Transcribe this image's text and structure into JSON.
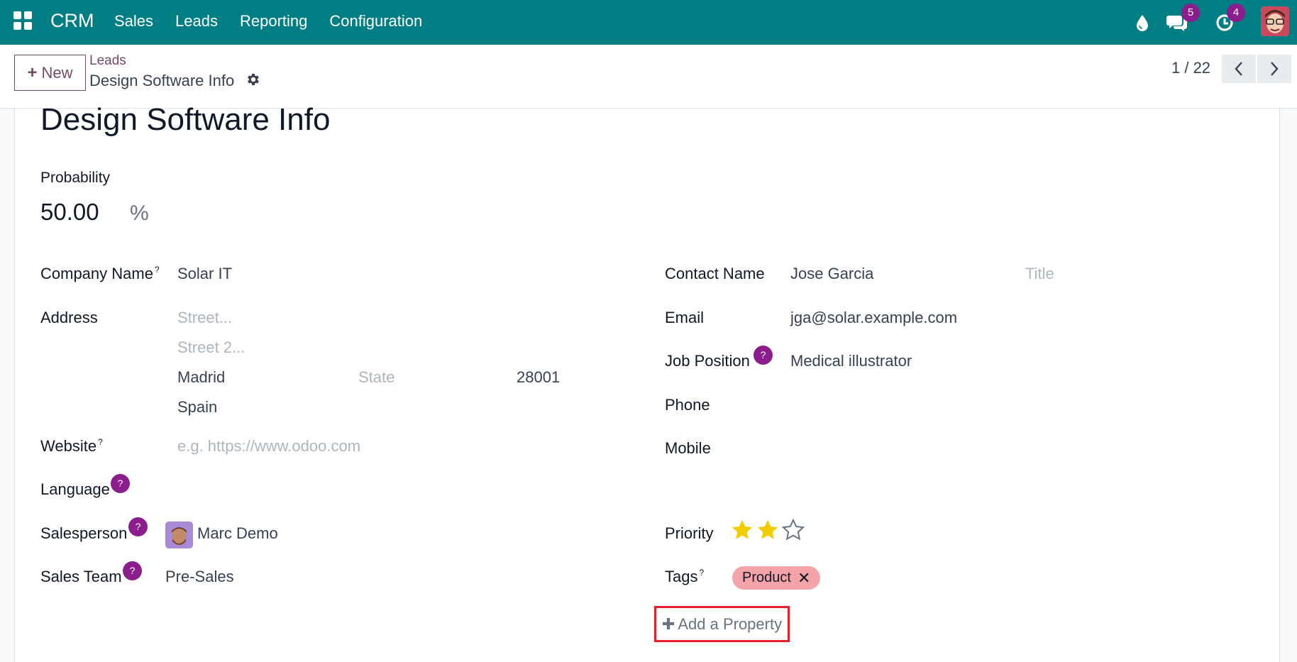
{
  "navbar": {
    "brand": "CRM",
    "menu": [
      "Sales",
      "Leads",
      "Reporting",
      "Configuration"
    ],
    "messages_count": "5",
    "activities_count": "4"
  },
  "control": {
    "new_label": "New",
    "breadcrumb_parent": "Leads",
    "breadcrumb_current": "Design Software Info",
    "pager": "1 / 22"
  },
  "form": {
    "title": "Design Software Info",
    "probability_label": "Probability",
    "probability_value": "50.00",
    "probability_unit": "%",
    "company_name_label": "Company Name",
    "company_name": "Solar IT",
    "address_label": "Address",
    "street_placeholder": "Street...",
    "street2_placeholder": "Street 2...",
    "city": "Madrid",
    "state_placeholder": "State",
    "zip": "28001",
    "country": "Spain",
    "website_label": "Website",
    "website_placeholder": "e.g. https://www.odoo.com",
    "language_label": "Language",
    "salesperson_label": "Salesperson",
    "salesperson": "Marc Demo",
    "sales_team_label": "Sales Team",
    "sales_team": "Pre-Sales",
    "contact_name_label": "Contact Name",
    "contact_name": "Jose Garcia",
    "title_placeholder": "Title",
    "email_label": "Email",
    "email": "jga@solar.example.com",
    "job_position_label": "Job Position",
    "job_position": "Medical illustrator",
    "phone_label": "Phone",
    "mobile_label": "Mobile",
    "priority_label": "Priority",
    "priority_stars": 2,
    "priority_max": 3,
    "tags_label": "Tags",
    "tag": "Product",
    "add_property": "Add a Property",
    "tooltip_mark": "?",
    "tooltip_sup": "?"
  },
  "colors": {
    "navbar": "#017e84",
    "primary": "#714b67",
    "badge": "#8b1d8c",
    "star": "#f3cc00",
    "tag": "#f4a3a8",
    "highlight": "#e3202b"
  }
}
